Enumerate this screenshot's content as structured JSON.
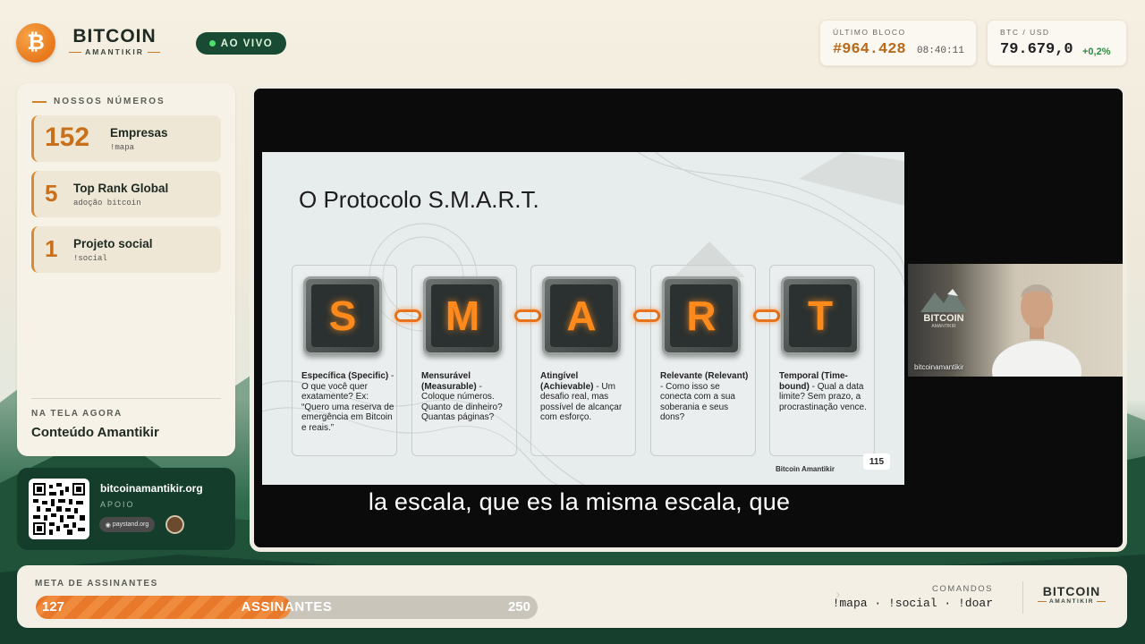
{
  "brand": {
    "name": "BITCOIN",
    "sub": "AMANTIKIR",
    "logo_glyph": "₿"
  },
  "live": {
    "label": "AO VIVO"
  },
  "last_block": {
    "label": "ÚLTIMO BLOCO",
    "value": "#964.428",
    "time": "08:40:11"
  },
  "btc": {
    "label": "BTC / USD",
    "value": "79.679,0",
    "change": "+0,2%"
  },
  "numbers": {
    "title": "NOSSOS NÚMEROS",
    "items": [
      {
        "value": "152",
        "title": "Empresas",
        "sub": "!mapa"
      },
      {
        "value": "5",
        "title": "Top Rank Global",
        "sub": "adoção bitcoin"
      },
      {
        "value": "1",
        "title": "Projeto social",
        "sub": "!social"
      }
    ]
  },
  "now": {
    "label": "NA TELA AGORA",
    "value": "Conteúdo Amantikir"
  },
  "support": {
    "site": "bitcoinamantikir.org",
    "label": "APOIO",
    "partner": "paystand.org"
  },
  "slide": {
    "title": "O Protocolo S.M.A.R.T.",
    "letters": [
      "S",
      "M",
      "A",
      "R",
      "T"
    ],
    "cards": [
      {
        "head": "Específica (Specific)",
        "text": " - O que você quer exatamente? Ex: “Quero uma reserva de emergência em Bitcoin e reais.”"
      },
      {
        "head": "Mensurável (Measurable)",
        "text": " - Coloque números. Quanto de dinheiro? Quantas páginas?"
      },
      {
        "head": "Atingível (Achievable)",
        "text": " - Um desafio real, mas possível de alcançar com esforço."
      },
      {
        "head": "Relevante (Relevant)",
        "text": " - Como isso se conecta com a sua soberania e seus dons?"
      },
      {
        "head": "Temporal (Time-bound)",
        "text": " - Qual a data limite? Sem prazo, a procrastinação vence."
      }
    ],
    "footer": "Bitcoin Amantikir",
    "page": "115"
  },
  "webcam": {
    "caption": "bitcoinamantikir",
    "logo_text": "BITCOIN",
    "logo_sub": "AMANTIKIR"
  },
  "subtitle": "la escala, que es la misma escala, que",
  "goal": {
    "label": "META DE ASSINANTES",
    "current": "127",
    "text": "ASSINANTES",
    "target": "250",
    "progress": 0.508
  },
  "commands": {
    "label": "COMANDOS",
    "value": "!mapa · !social · !doar"
  },
  "colors": {
    "accent": "#e8781b",
    "dark_green": "#143d2c",
    "live_dot": "#4ee06d",
    "positive": "#2f8a3f"
  }
}
